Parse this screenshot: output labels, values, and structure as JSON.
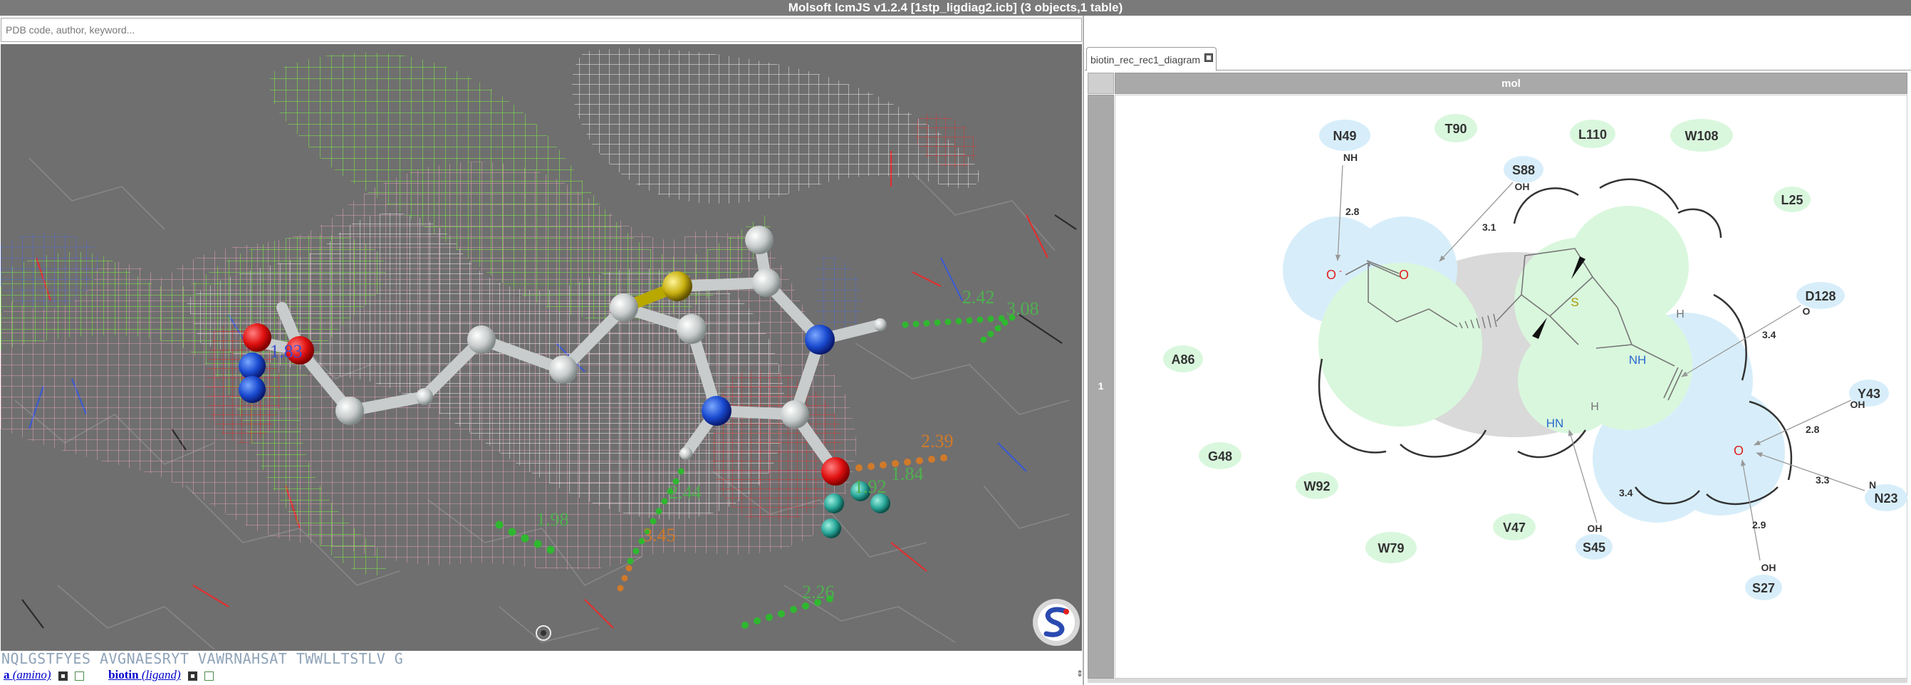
{
  "app": {
    "title": "Molsoft IcmJS v1.2.4 [1stp_ligdiag2.icb] (3 objects,1 table)"
  },
  "search": {
    "placeholder": "PDB code, author, keyword..."
  },
  "viewer": {
    "distances": [
      {
        "label": "1.83",
        "color": "#3b4fd0"
      },
      {
        "label": "2.42",
        "color": "#4fb04f"
      },
      {
        "label": "3.08",
        "color": "#4fb04f"
      },
      {
        "label": "2.39",
        "color": "#d07a2a"
      },
      {
        "label": "1.92",
        "color": "#4fb04f"
      },
      {
        "label": "1.84",
        "color": "#4fb04f"
      },
      {
        "label": "2.44",
        "color": "#4fb04f"
      },
      {
        "label": "3.45",
        "color": "#d07a2a"
      },
      {
        "label": "1.98",
        "color": "#4fb04f"
      },
      {
        "label": "2.26",
        "color": "#4fb04f"
      }
    ],
    "logo_icon": "molsoft-logo-icon",
    "center_icon": "rotation-center-icon"
  },
  "sequence": {
    "text": "NQLGSTFYES AVGNAESRYT VAWRNAHSAT TWWLLTSTLV G"
  },
  "objects": [
    {
      "name": "a",
      "type": "(amino)"
    },
    {
      "name": "biotin",
      "type": "(ligand)"
    }
  ],
  "table": {
    "tab_label": "biotin_rec_rec1_diagram",
    "column_header": "mol",
    "row_label": "1"
  },
  "diagram": {
    "residues": [
      {
        "label": "N49",
        "kind": "polar"
      },
      {
        "label": "T90",
        "kind": "hydrophobic"
      },
      {
        "label": "L110",
        "kind": "hydrophobic"
      },
      {
        "label": "W108",
        "kind": "hydrophobic"
      },
      {
        "label": "S88",
        "kind": "polar"
      },
      {
        "label": "L25",
        "kind": "hydrophobic"
      },
      {
        "label": "D128",
        "kind": "polar"
      },
      {
        "label": "A86",
        "kind": "hydrophobic"
      },
      {
        "label": "Y43",
        "kind": "polar"
      },
      {
        "label": "G48",
        "kind": "hydrophobic"
      },
      {
        "label": "W92",
        "kind": "hydrophobic"
      },
      {
        "label": "N23",
        "kind": "polar"
      },
      {
        "label": "V47",
        "kind": "hydrophobic"
      },
      {
        "label": "W79",
        "kind": "hydrophobic"
      },
      {
        "label": "S45",
        "kind": "polar"
      },
      {
        "label": "S27",
        "kind": "polar"
      }
    ],
    "donor_labels": [
      "NH",
      "OH",
      "O",
      "OH",
      "N",
      "OH",
      "OH"
    ],
    "hbond_distances": [
      "2.8",
      "3.1",
      "3.4",
      "2.8",
      "3.3",
      "3.4",
      "2.9"
    ],
    "atom_labels": {
      "o_minus": "O",
      "charge": "-",
      "o_carboxyl": "O",
      "sulfur": "S",
      "nh_right": "NH",
      "hn_left": "HN",
      "o_urea": "O",
      "h_top": "H",
      "h_bottom": "H"
    },
    "colors": {
      "hydrophobic": "#d9f7dd",
      "polar": "#d7eefa",
      "exposure": "#d9d9d9",
      "bond": "#777777",
      "oxygen": "#e02020",
      "nitrogen": "#2a6ad0",
      "sulfur": "#b8a800"
    }
  }
}
